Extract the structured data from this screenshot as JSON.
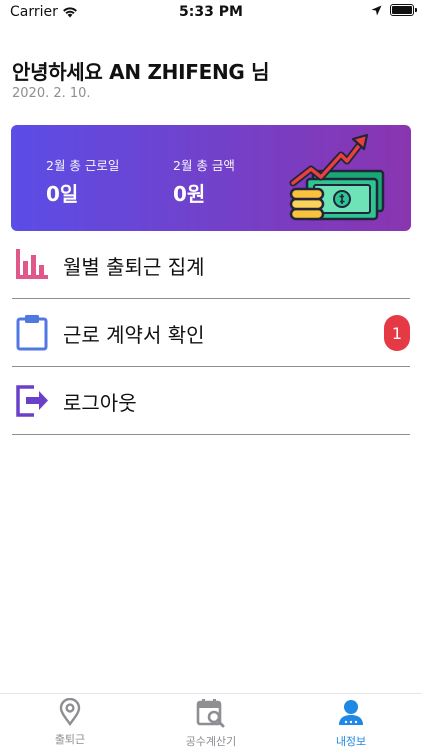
{
  "status_bar": {
    "carrier": "Carrier",
    "time": "5:33 PM"
  },
  "header": {
    "greeting": "안녕하세요 AN ZHIFENG 님",
    "date": "2020. 2. 10."
  },
  "summary": {
    "days_label": "2월 총 근로일",
    "days_value": "0일",
    "amount_label": "2월 총 금액",
    "amount_value": "0원"
  },
  "menu": [
    {
      "label": "월별 출퇴근 집계",
      "icon": "bar-chart-icon"
    },
    {
      "label": "근로 계약서 확인",
      "icon": "clipboard-icon",
      "badge": "1"
    },
    {
      "label": "로그아웃",
      "icon": "logout-icon"
    }
  ],
  "tabs": [
    {
      "label": "출퇴근",
      "icon": "location-pin-icon",
      "active": false
    },
    {
      "label": "공수계산기",
      "icon": "calendar-search-icon",
      "active": false
    },
    {
      "label": "내정보",
      "icon": "user-icon",
      "active": true
    }
  ],
  "colors": {
    "accent": "#1e88e5",
    "card_gradient_start": "#5b4de6",
    "card_gradient_end": "#8a35b0",
    "badge": "#e53945",
    "chart_icon": "#e0588a",
    "clipboard_icon": "#4f78e0",
    "logout_icon": "#6a40c8"
  }
}
